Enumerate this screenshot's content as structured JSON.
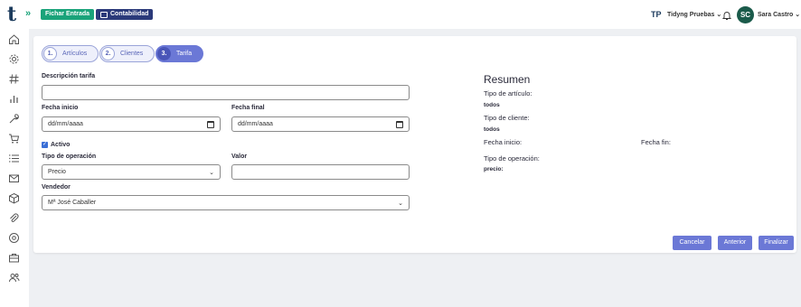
{
  "topbar": {
    "logo": "t",
    "expand": "»",
    "fichar_label": "Fichar Entrada",
    "contabilidad_label": "Contabilidad",
    "company_abbr": "TP",
    "company_name": "Tidyng Pruebas ⌄",
    "user_initials": "SC",
    "user_name": "Sara Castro ⌄"
  },
  "sidebar": {
    "icons": [
      "home-icon",
      "gear-icon",
      "hash-icon",
      "bar-chart-icon",
      "wrench-icon",
      "cart-icon",
      "list-icon",
      "mail-icon",
      "box-icon",
      "paperclip-icon",
      "coin-icon",
      "briefcase-icon",
      "users-icon"
    ]
  },
  "steps": [
    {
      "num": "1.",
      "label": "Artículos"
    },
    {
      "num": "2.",
      "label": "Clientes"
    },
    {
      "num": "3.",
      "label": "Tarifa"
    }
  ],
  "form": {
    "descripcion_label": "Descripción tarifa",
    "descripcion_value": "",
    "fecha_inicio_label": "Fecha inicio",
    "fecha_inicio_value": "dd/mm/aaaa",
    "fecha_final_label": "Fecha final",
    "fecha_final_value": "dd/mm/aaaa",
    "activo_label": "Activo",
    "activo_checked": true,
    "tipo_operacion_label": "Tipo de operación",
    "tipo_operacion_value": "Precio",
    "valor_label": "Valor",
    "valor_value": "",
    "vendedor_label": "Vendedor",
    "vendedor_value": "Mª José Caballer"
  },
  "resumen": {
    "title": "Resumen",
    "tipo_articulo_label": "Tipo de artículo:",
    "tipo_articulo_value": "todos",
    "tipo_cliente_label": "Tipo de cliente:",
    "tipo_cliente_value": "todos",
    "fecha_inicio_label": "Fecha inicio:",
    "fecha_fin_label": "Fecha fin:",
    "tipo_operacion_label": "Tipo de operación:",
    "tipo_operacion_value": "precio:"
  },
  "buttons": {
    "cancel": "Cancelar",
    "previous": "Anterior",
    "finish": "Finalizar"
  },
  "colors": {
    "green": "#1aa37a",
    "navy": "#2b3a7a",
    "accent": "#6b78d6"
  }
}
